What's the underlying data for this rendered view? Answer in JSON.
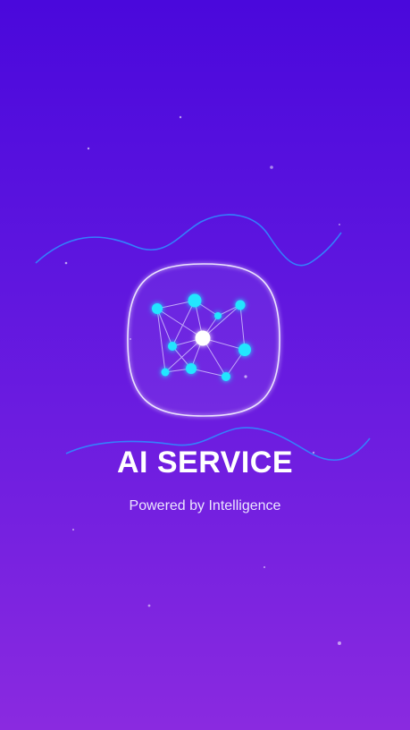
{
  "splash": {
    "title": "AI SERVICE",
    "subtitle": "Powered by Intelligence",
    "logo_icon": "neural-network-icon"
  },
  "colors": {
    "background_top": "#4a08dc",
    "background_bottom": "#8a2ae0",
    "node": "#22e6ff",
    "core_node": "#ffffff",
    "wave": "#2f8cff",
    "text": "#ffffff"
  }
}
